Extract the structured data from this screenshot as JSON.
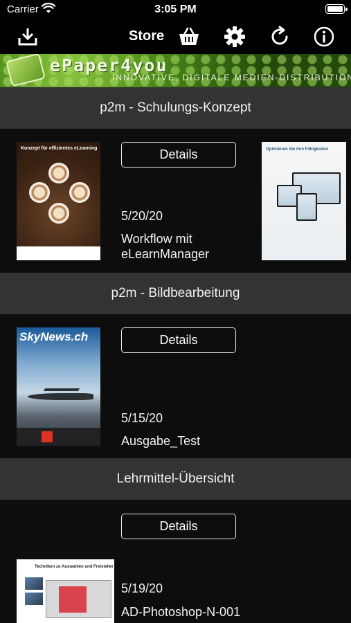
{
  "status_bar": {
    "carrier": "Carrier",
    "time": "3:05 PM"
  },
  "toolbar": {
    "title": "Store",
    "icons": [
      "download-icon",
      "basket-icon",
      "gear-icon",
      "refresh-icon",
      "info-icon"
    ]
  },
  "banner": {
    "brand": "ePaper4you",
    "tagline": "innovative, digitale Medien-Distribution"
  },
  "sections": [
    {
      "header": "p2m - Schulungs-Konzept",
      "items": [
        {
          "cover_title": "Konzept für effizientes eLearning",
          "details_label": "Details",
          "date": "5/20/20",
          "title": "Workflow mit eLearnManager"
        },
        {
          "cover_title": "Optimieren Sie Ihre Fähigkeiten"
        }
      ]
    },
    {
      "header": "p2m - Bildbearbeitung",
      "items": [
        {
          "cover_title": "SkyNews.ch",
          "details_label": "Details",
          "date": "5/15/20",
          "title": "Ausgabe_Test"
        }
      ]
    },
    {
      "header": "Lehrmittel-Übersicht",
      "items": [
        {
          "cover_title": "Techniken zu Auswahlen und Freisteller",
          "details_label": "Details",
          "date": "5/19/20",
          "title": "AD-Photoshop-N-001"
        }
      ]
    }
  ],
  "colors": {
    "background": "#0d0d0d",
    "section_header": "#333333",
    "toolbar": "#000000",
    "banner_green": "#4a8a1a"
  }
}
